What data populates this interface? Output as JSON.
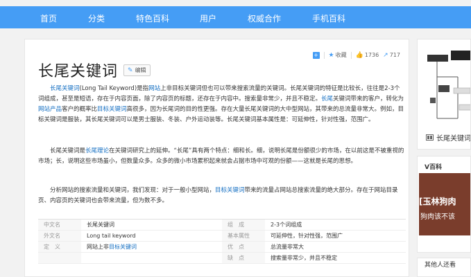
{
  "nav": {
    "items": [
      "首页",
      "分类",
      "特色百科",
      "用户",
      "权威合作",
      "手机百科"
    ]
  },
  "entry": {
    "title": "长尾关键词",
    "edit_label": "编辑",
    "collect_label": "收藏",
    "like_count": "1736",
    "share_count": "717"
  },
  "paragraphs": [
    {
      "segments": [
        {
          "t": "长尾关键词",
          "link": true
        },
        {
          "t": "(Long Tail Keyword)是指",
          "link": false
        },
        {
          "t": "网站",
          "link": true
        },
        {
          "t": "上非目标关键词但也可以带来搜索流量的关键词。长尾关键词的特征是比较长，往往是2-3个词组成，甚至是短语，存在于内容页面，除了内容页的标题，还存在于内容中。搜索量非常少，并且不稳定。",
          "link": false
        },
        {
          "t": "长尾",
          "link": true
        },
        {
          "t": "关键词带来的客户，转化为",
          "link": false
        },
        {
          "t": "网站产品",
          "link": true
        },
        {
          "t": "客户的概率比",
          "link": false
        },
        {
          "t": "目标关键词",
          "link": true
        },
        {
          "t": "高很多，因为长尾词的目的性更强。存在大量长尾关键词的大中型网站，其带来的总流量非常大。例如，目标关键词是服装，其长尾关键词可以是男士服装、冬装、户外运动装等。长尾关键词基本属性是：可延伸性，针对性强，范围广。",
          "link": false
        }
      ]
    },
    {
      "segments": [
        {
          "t": "长尾关键词是",
          "link": false
        },
        {
          "t": "长尾理论",
          "link": true
        },
        {
          "t": "在关键词研究上的延伸。“长尾”具有两个特点：细和长。细，说明长尾是份额很少的市场，在以前这是不被重视的市场；长，说明这些市场虽小，但数量众多。众多的微小市场累积起来就会占据市场中可观的份额——这就是长尾的思想。",
          "link": false
        }
      ]
    },
    {
      "segments": [
        {
          "t": "分析网站的搜索流量和关键词，我们发现：对于一般小型网站，",
          "link": false
        },
        {
          "t": "目标关键词",
          "link": true
        },
        {
          "t": "带来的流量占网站总搜索流量的绝大部分。存在于网站目录页、内容页的关键词也会带来流量，但为数不多。",
          "link": false
        }
      ]
    }
  ],
  "basic_info": [
    {
      "name": "中文名",
      "value": "长尾关键词",
      "name2": "组　成",
      "value2": "2-3个词组成"
    },
    {
      "name": "外文名",
      "value": "Long tail keyword",
      "name2": "基本属性",
      "value2": "可延伸性，针对性强，范围广"
    },
    {
      "name": "定　义",
      "value": "网站上非目标关键词",
      "name2": "优　点",
      "value2": "总流量非常大"
    },
    {
      "name": "",
      "value": "",
      "name2": "缺　点",
      "value2": "搜索量非常少，并且不稳定"
    }
  ],
  "sidebar": {
    "caption": "长尾关键词",
    "vbaike_title": "V百科",
    "banner_line1": "[玉林狗肉",
    "banner_line2": "狗肉该不该",
    "more_title": "其他人还看"
  }
}
